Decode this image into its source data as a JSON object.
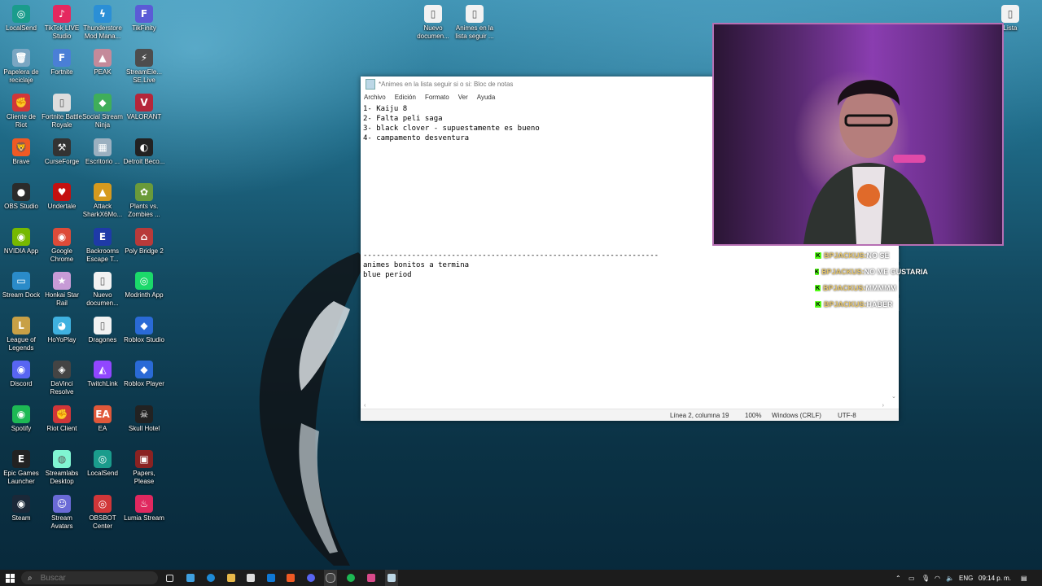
{
  "desktop": {
    "icons": [
      {
        "label": "LocalSend",
        "glyph": "◎",
        "color": "#1a9c8c"
      },
      {
        "label": "TikTok LIVE Studio",
        "glyph": "♪",
        "color": "#e5285f"
      },
      {
        "label": "Thunderstore Mod Mana...",
        "glyph": "ϟ",
        "color": "#2b8fd6"
      },
      {
        "label": "TikFinity",
        "glyph": "F",
        "color": "#5b5bd6"
      },
      {
        "label": "Papelera de reciclaje",
        "glyph": "🗑",
        "color": "#7aa6c2"
      },
      {
        "label": "Fortnite",
        "glyph": "F",
        "color": "#4a7fd6"
      },
      {
        "label": "PEAK",
        "glyph": "▲",
        "color": "#c48a9a"
      },
      {
        "label": "StreamEle... SE.Live",
        "glyph": "⚡",
        "color": "#4d4d4d"
      },
      {
        "label": "Cliente de Riot",
        "glyph": "✊",
        "color": "#d13639"
      },
      {
        "label": "Fortnite Battle Royale",
        "glyph": "▯",
        "color": "#dddddd"
      },
      {
        "label": "Social Stream Ninja",
        "glyph": "◆",
        "color": "#3fae5a"
      },
      {
        "label": "VALORANT",
        "glyph": "V",
        "color": "#b5263a"
      },
      {
        "label": "Brave",
        "glyph": "🦁",
        "color": "#f05a24"
      },
      {
        "label": "CurseForge",
        "glyph": "⚒",
        "color": "#333333"
      },
      {
        "label": "Escritorio ...",
        "glyph": "▦",
        "color": "#9bb0c0"
      },
      {
        "label": "Detroit Beco...",
        "glyph": "◐",
        "color": "#222222"
      },
      {
        "label": "OBS Studio",
        "glyph": "●",
        "color": "#2b2b2b"
      },
      {
        "label": "Undertale",
        "glyph": "♥",
        "color": "#c41010"
      },
      {
        "label": "Attack SharkX6Mo...",
        "glyph": "▲",
        "color": "#d69a1e"
      },
      {
        "label": "Plants vs. Zombies ...",
        "glyph": "✿",
        "color": "#6a9a3a"
      },
      {
        "label": "NVIDIA App",
        "glyph": "◉",
        "color": "#76b900"
      },
      {
        "label": "Google Chrome",
        "glyph": "◉",
        "color": "#dd4b39"
      },
      {
        "label": "Backrooms Escape T...",
        "glyph": "E",
        "color": "#1e3aa8"
      },
      {
        "label": "Poly Bridge 2",
        "glyph": "⌂",
        "color": "#b83a3a"
      },
      {
        "label": "Stream Dock",
        "glyph": "▭",
        "color": "#2a8bc9"
      },
      {
        "label": "Honkai Star Rail",
        "glyph": "★",
        "color": "#c79bd6"
      },
      {
        "label": "Nuevo documen...",
        "glyph": "▯",
        "color": "#f2f2f2"
      },
      {
        "label": "Modrinth App",
        "glyph": "◎",
        "color": "#1bd96a"
      },
      {
        "label": "League of Legends",
        "glyph": "L",
        "color": "#c8a046"
      },
      {
        "label": "HoYoPlay",
        "glyph": "◕",
        "color": "#3fb1e0"
      },
      {
        "label": "Dragones",
        "glyph": "▯",
        "color": "#f2f2f2"
      },
      {
        "label": "Roblox Studio",
        "glyph": "◆",
        "color": "#2a6ad6"
      },
      {
        "label": "Discord",
        "glyph": "◉",
        "color": "#5865f2"
      },
      {
        "label": "DaVinci Resolve",
        "glyph": "◈",
        "color": "#444444"
      },
      {
        "label": "TwitchLink",
        "glyph": "◭",
        "color": "#9146ff"
      },
      {
        "label": "Roblox Player",
        "glyph": "◆",
        "color": "#2a6ad6"
      },
      {
        "label": "Spotify",
        "glyph": "◉",
        "color": "#1db954"
      },
      {
        "label": "Riot Client",
        "glyph": "✊",
        "color": "#d13639"
      },
      {
        "label": "EA",
        "glyph": "EA",
        "color": "#e0583a"
      },
      {
        "label": "Skull Hotel",
        "glyph": "☠",
        "color": "#222222"
      },
      {
        "label": "Epic Games Launcher",
        "glyph": "E",
        "color": "#222222"
      },
      {
        "label": "Streamlabs Desktop",
        "glyph": "◍",
        "color": "#80f5d2"
      },
      {
        "label": "LocalSend",
        "glyph": "◎",
        "color": "#1a9c8c"
      },
      {
        "label": "Papers, Please",
        "glyph": "▣",
        "color": "#8a2222"
      },
      {
        "label": "Steam",
        "glyph": "◉",
        "color": "#1b2838"
      },
      {
        "label": "Stream Avatars",
        "glyph": "☺",
        "color": "#6a6ad6"
      },
      {
        "label": "OBSBOT Center",
        "glyph": "◎",
        "color": "#d13639"
      },
      {
        "label": "Lumia Stream",
        "glyph": "♨",
        "color": "#e0285f"
      },
      {
        "label": "Nuevo documen...",
        "glyph": "▯",
        "color": "#f2f2f2"
      },
      {
        "label": "Animes en la lista seguir ...",
        "glyph": "▯",
        "color": "#f2f2f2"
      },
      {
        "label": "Lista",
        "glyph": "▯",
        "color": "#f2f2f2"
      }
    ]
  },
  "notepad": {
    "title": "*Animes en la lista seguir si o si: Bloc de notas",
    "menu": [
      "Archivo",
      "Edición",
      "Formato",
      "Ver",
      "Ayuda"
    ],
    "content": "1- Kaiju 8\n2- Falta peli saga\n3- black clover - supuestamente es bueno\n4- campamento desventura\n\n\n\n\n\n\n\n\n\n\n\n-------------------------------------------------------------------\nanimes bonitos a termina\nblue period",
    "status": {
      "position": "Línea 2, columna 19",
      "zoom": "100%",
      "line_ending": "Windows (CRLF)",
      "encoding": "UTF-8"
    }
  },
  "chat": {
    "messages": [
      {
        "user": "BPJACKUS:",
        "text": "NO SE"
      },
      {
        "user": "BPJACKUS:",
        "text": "NO ME GUSTARIA"
      },
      {
        "user": "BPJACKUS:",
        "text": "MMMMM"
      },
      {
        "user": "BPJACKUS:",
        "text": "HABER"
      }
    ]
  },
  "taskbar": {
    "search_placeholder": "Buscar",
    "language": "ENG",
    "time": "09:14 p. m."
  }
}
